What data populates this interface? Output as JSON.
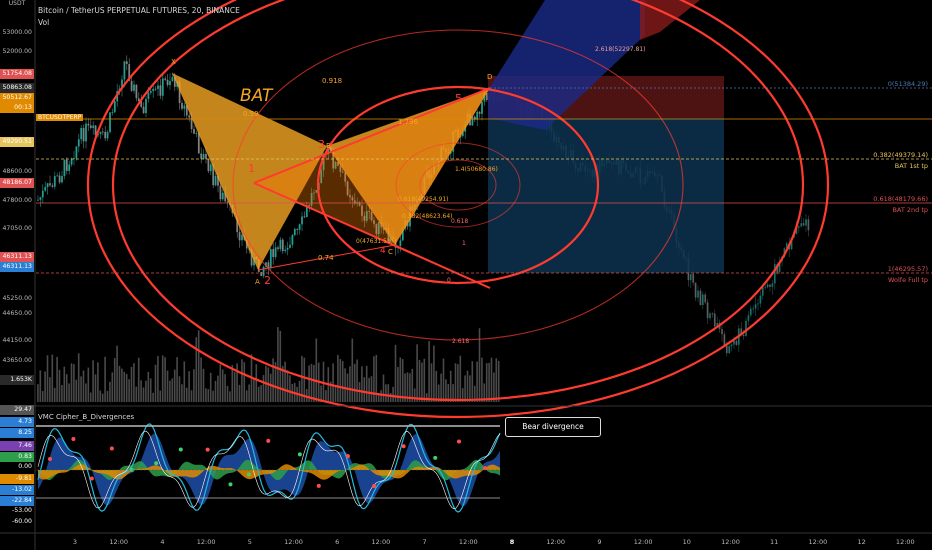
{
  "header": {
    "title": "Bitcoin / TetherUS PERPETUAL FUTURES, 20, BINANCE",
    "volume_label": "Vol",
    "currency": "USDT"
  },
  "price_axis": [
    {
      "label": "53000.00",
      "style": "plain"
    },
    {
      "label": "52000.00",
      "style": "plain"
    },
    {
      "label": "51754.08",
      "style": "box",
      "color": "#e05252"
    },
    {
      "label": "50863.08",
      "style": "box",
      "color": "#2a2a2a"
    },
    {
      "label": "50512.67",
      "style": "box",
      "color": "#e08a00"
    },
    {
      "label": "00:13",
      "style": "box",
      "color": "#e08a00"
    },
    {
      "label": "49290.51",
      "style": "box",
      "color": "#e6c65c"
    },
    {
      "label": "48600.00",
      "style": "plain"
    },
    {
      "label": "48186.07",
      "style": "box",
      "color": "#e05252"
    },
    {
      "label": "47800.00",
      "style": "plain"
    },
    {
      "label": "47050.00",
      "style": "plain"
    },
    {
      "label": "46311.13",
      "style": "box",
      "color": "#e05252"
    },
    {
      "label": "46311.13",
      "style": "box",
      "color": "#2a7fd4"
    },
    {
      "label": "45250.00",
      "style": "plain"
    },
    {
      "label": "44650.00",
      "style": "plain"
    },
    {
      "label": "44150.00",
      "style": "plain"
    },
    {
      "label": "43650.00",
      "style": "plain"
    },
    {
      "label": "1.653K",
      "style": "box",
      "color": "#2a2a2a"
    }
  ],
  "symbol_tag": "BTCUSDTPERP",
  "indicator": {
    "name": "VMC Cipher_B_Divergences",
    "axis": [
      {
        "label": "29.47",
        "color": "#555"
      },
      {
        "label": "4.73",
        "color": "#2a7fd4"
      },
      {
        "label": "8.25",
        "color": "#2a7fd4"
      },
      {
        "label": "7.46",
        "color": "#7a3fb0"
      },
      {
        "label": "0.83",
        "color": "#2e9e4a"
      },
      {
        "label": "0.00",
        "color": "#000"
      },
      {
        "label": "-9.81",
        "color": "#e08a00"
      },
      {
        "label": "-13.02",
        "color": "#2a7fd4"
      },
      {
        "label": "-22.84",
        "color": "#2a7fd4"
      },
      {
        "label": "-53.00",
        "color": "#000"
      },
      {
        "label": "-60.00",
        "color": "#000"
      }
    ],
    "callout": "Bear divergence"
  },
  "time_axis": [
    "3",
    "12:00",
    "4",
    "12:00",
    "5",
    "12:00",
    "6",
    "12:00",
    "7",
    "12:00",
    "8",
    "12:00",
    "9",
    "12:00",
    "10",
    "12:00",
    "11",
    "12:00",
    "12",
    "12:00"
  ],
  "levels": [
    {
      "label": "0(51384.29)",
      "color": "#4a7ab0"
    },
    {
      "label": "0.382(49379.14)",
      "color": "#e6c65c"
    },
    {
      "label": "BAT 1st tp",
      "color": "#e6c65c"
    },
    {
      "label": "0.618(48179.66)",
      "color": "#e05252"
    },
    {
      "label": "BAT 2nd tp",
      "color": "#e05252"
    },
    {
      "label": "1(46295.57)",
      "color": "#e05252"
    },
    {
      "label": "Wolfe Full tp",
      "color": "#e05252"
    }
  ],
  "pattern_labels": {
    "bat": "BAT",
    "x": "X",
    "a": "A",
    "b": "B",
    "c": "C",
    "d": "D",
    "p1": "1",
    "p2": "2",
    "p3": "3",
    "p4": "4",
    "p5": "5",
    "r0918": "0.918",
    "r059": "0.59",
    "r074": "0.74",
    "r1796": "1.796",
    "fib_ext": "2.618(52297.81)",
    "fib_2618": "2.618",
    "fib_1": "1",
    "fib_0618": "0.618",
    "fib_0": "0",
    "fib_14": "1.4(50680.86)",
    "fib_a": "0(47631.59)",
    "fib_b": "0.618(49254.91)",
    "fib_c": "0.382(48623.64)"
  },
  "colors": {
    "bg": "#000000",
    "circle": "#ff3b30",
    "bat_fill": "#f5a623",
    "short_zone": "#0d3350",
    "stop_zone": "#5a1616",
    "up": "#26a69a",
    "down": "#8a8a8a"
  }
}
